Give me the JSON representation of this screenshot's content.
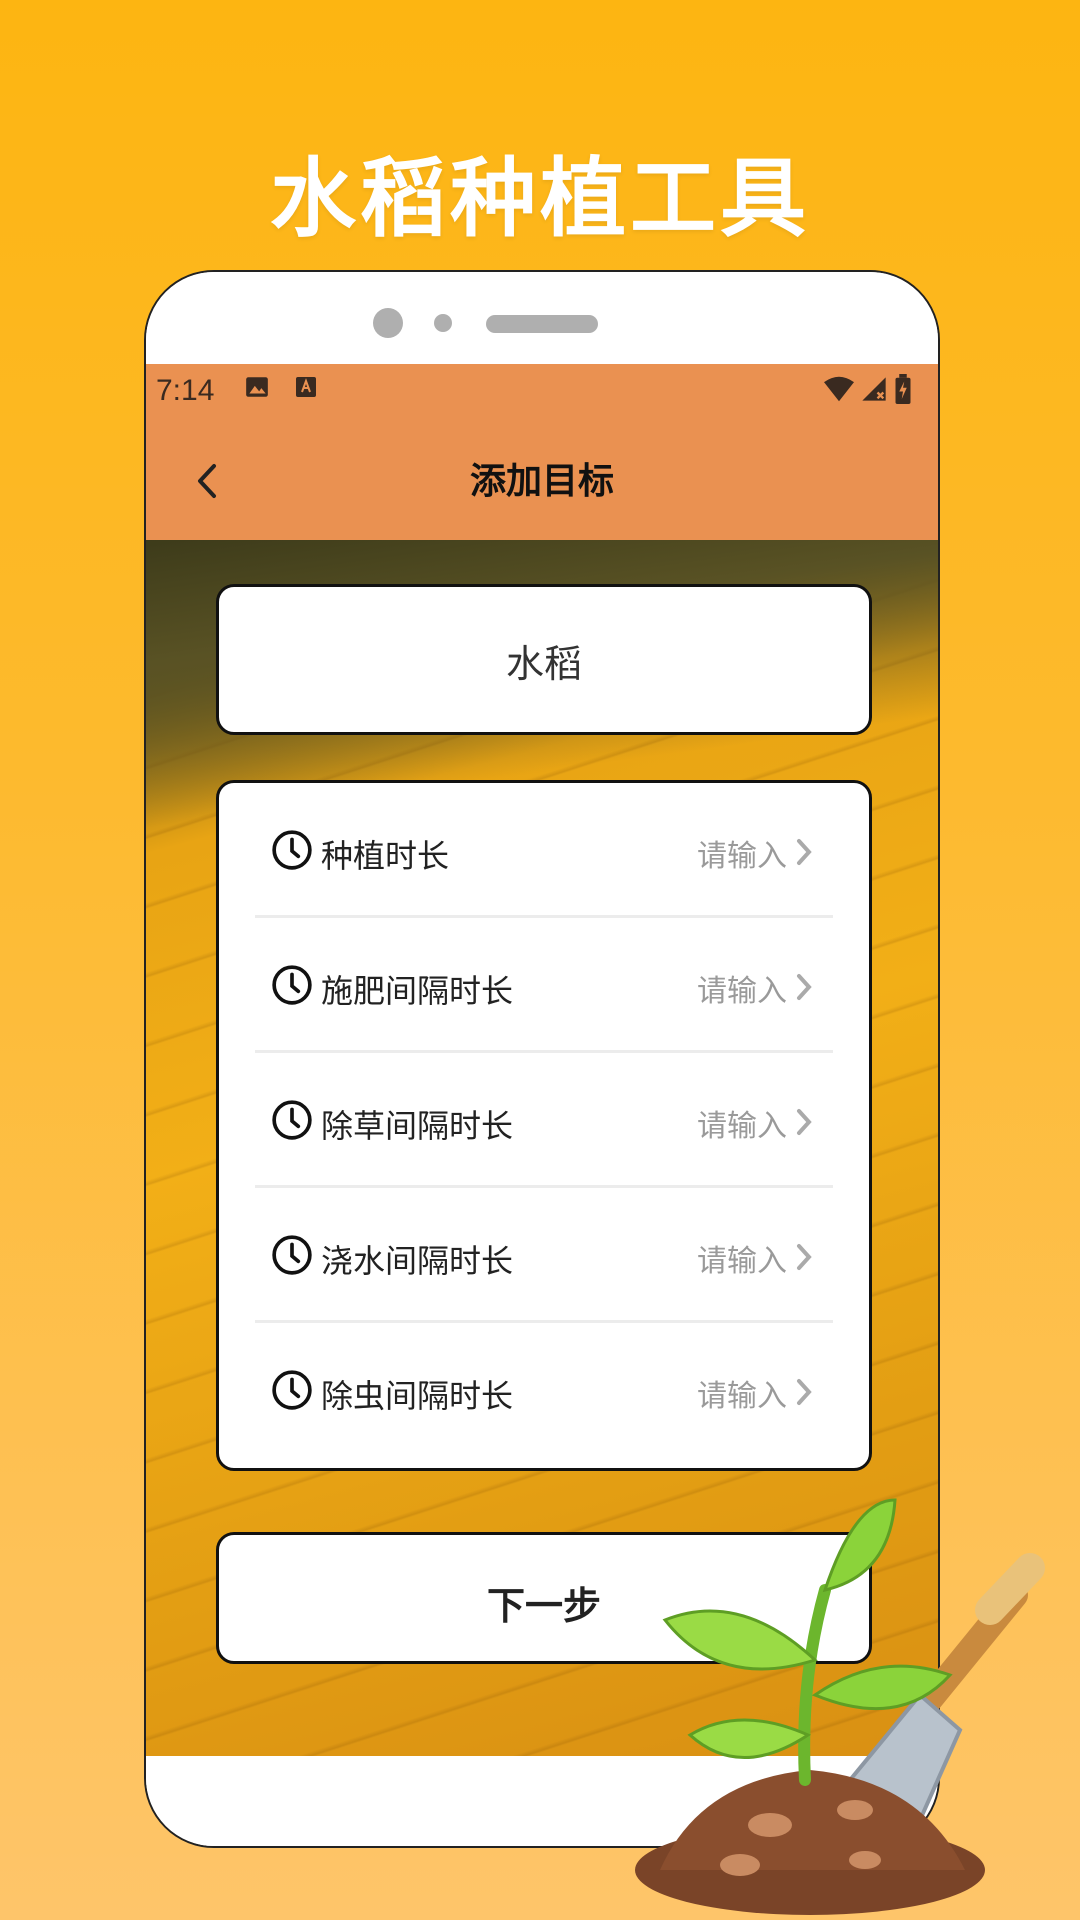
{
  "promo": {
    "title": "水稻种植工具"
  },
  "status_bar": {
    "time": "7:14"
  },
  "app_bar": {
    "title": "添加目标"
  },
  "crop": {
    "name": "水稻"
  },
  "settings": [
    {
      "label": "种植时长",
      "placeholder": "请输入"
    },
    {
      "label": "施肥间隔时长",
      "placeholder": "请输入"
    },
    {
      "label": "除草间隔时长",
      "placeholder": "请输入"
    },
    {
      "label": "浇水间隔时长",
      "placeholder": "请输入"
    },
    {
      "label": "除虫间隔时长",
      "placeholder": "请输入"
    }
  ],
  "actions": {
    "next_label": "下一步"
  },
  "colors": {
    "background": "#FDB511",
    "app_bar": "#EA9151",
    "hint": "#9a9a9a"
  },
  "icons": [
    "back-arrow-icon",
    "clock-icon",
    "chevron-right-icon",
    "image-icon",
    "font-icon",
    "wifi-icon",
    "signal-icon",
    "battery-icon",
    "sprout-illustration"
  ]
}
